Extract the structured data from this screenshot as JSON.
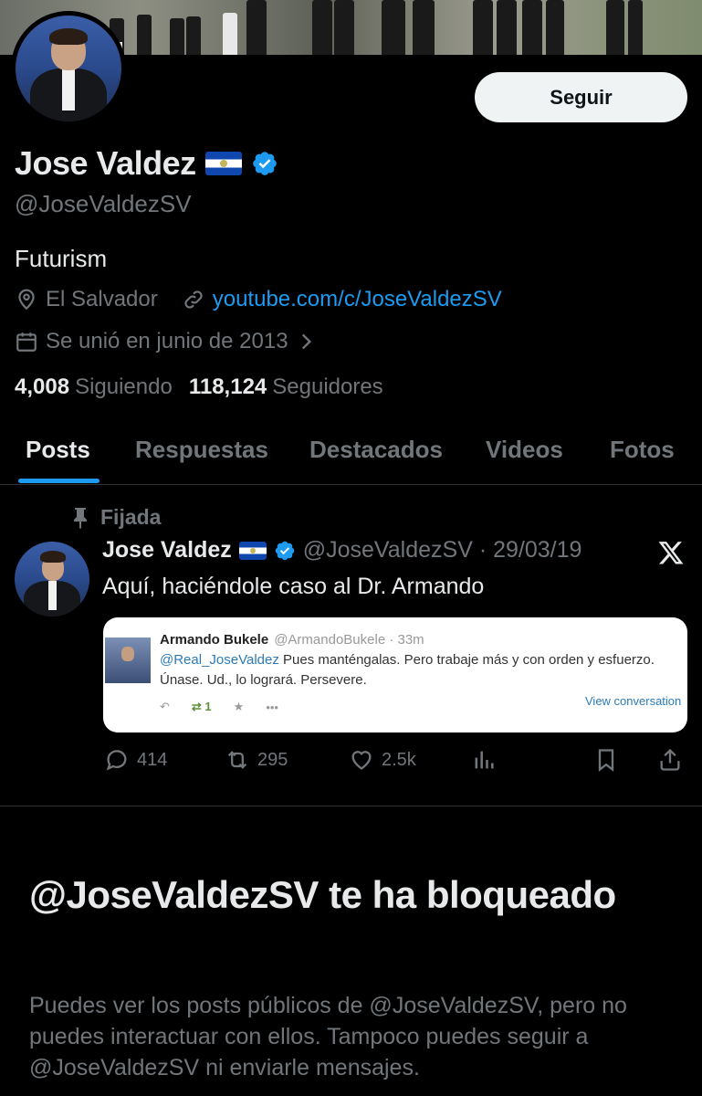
{
  "profile": {
    "name": "Jose Valdez",
    "handle": "@JoseValdezSV",
    "bio": "Futurism",
    "location": "El Salvador",
    "website": "youtube.com/c/JoseValdezSV",
    "joined": "Se unió en junio de 2013",
    "following_count": "4,008",
    "following_label": "Siguiendo",
    "followers_count": "118,124",
    "followers_label": "Seguidores",
    "follow_button": "Seguir"
  },
  "tabs": [
    {
      "label": "Posts",
      "active": true
    },
    {
      "label": "Respuestas",
      "active": false
    },
    {
      "label": "Destacados",
      "active": false
    },
    {
      "label": "Videos",
      "active": false
    },
    {
      "label": "Fotos",
      "active": false
    }
  ],
  "pinned_post": {
    "pinned_label": "Fijada",
    "author_name": "Jose Valdez",
    "handle_date": "@JoseValdezSV · 29/03/19",
    "text": "Aquí, haciéndole caso al Dr. Armando",
    "embed": {
      "author": "Armando Bukele",
      "meta": "@ArmandoBukele · 33m",
      "mention": "@Real_JoseValdez",
      "text": " Pues manténgalas. Pero trabaje más y con orden y esfuerzo. Únase. Ud., lo logrará. Persevere.",
      "retweets": "1",
      "more": "•••",
      "view_link": "View conversation"
    },
    "stats": {
      "replies": "414",
      "reposts": "295",
      "likes": "2.5k"
    }
  },
  "blocked": {
    "title": "@JoseValdezSV te ha bloqueado",
    "description": "Puedes ver los posts públicos de @JoseValdezSV, pero no puedes interactuar con ellos. Tampoco puedes seguir a @JoseValdezSV ni enviarle mensajes."
  },
  "colors": {
    "background": "#000000",
    "text_primary": "#e7e9ea",
    "text_secondary": "#71767b",
    "accent": "#1d9bf0",
    "button_bg": "#eff3f4"
  },
  "icons": [
    "location-icon",
    "link-icon",
    "calendar-icon",
    "chevron-right-icon",
    "verified-badge-icon",
    "pin-icon",
    "x-logo-icon",
    "reply-icon",
    "repost-icon",
    "like-icon",
    "views-icon",
    "bookmark-icon",
    "share-icon"
  ]
}
